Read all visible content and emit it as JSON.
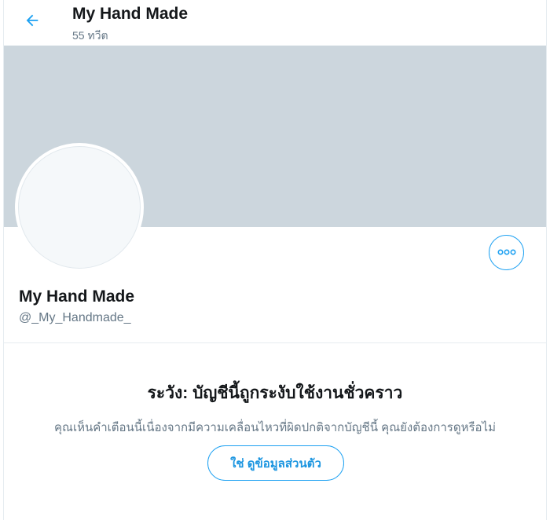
{
  "header": {
    "title": "My Hand Made",
    "tweet_count": "55 ทวีต",
    "back_icon": "arrow-left-icon"
  },
  "profile": {
    "name": "My Hand Made",
    "handle": "@_My_Handmade_",
    "more_icon": "more-horizontal-icon"
  },
  "warning": {
    "title": "ระวัง: บัญชีนี้ถูกระงับใช้งานชั่วคราว",
    "text": "คุณเห็นคำเตือนนี้เนื่องจากมีความเคลื่อนไหวที่ผิดปกติจากบัญชีนี้ คุณยังต้องการดูหรือไม่",
    "button_label": "ใช่ ดูข้อมูลส่วนตัว"
  },
  "colors": {
    "accent": "#1da1f2",
    "banner": "#ccd6dd",
    "secondary_text": "#657786"
  }
}
